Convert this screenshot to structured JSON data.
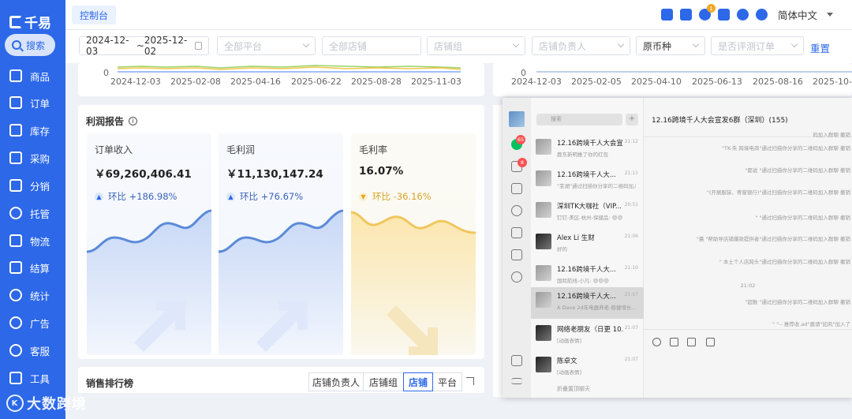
{
  "app": {
    "logo_text": "千易",
    "search_label": "搜索",
    "watermark": "大数跨境"
  },
  "sidebar": {
    "items": [
      {
        "label": "商品",
        "icon": "package-icon"
      },
      {
        "label": "订单",
        "icon": "order-icon"
      },
      {
        "label": "库存",
        "icon": "warehouse-icon"
      },
      {
        "label": "采购",
        "icon": "cart-icon"
      },
      {
        "label": "分销",
        "icon": "distribution-icon"
      },
      {
        "label": "托管",
        "icon": "hosting-icon"
      },
      {
        "label": "物流",
        "icon": "truck-icon"
      },
      {
        "label": "结算",
        "icon": "settlement-icon"
      },
      {
        "label": "统计",
        "icon": "pie-chart-icon"
      },
      {
        "label": "广告",
        "icon": "ad-icon"
      },
      {
        "label": "客服",
        "icon": "headset-icon"
      },
      {
        "label": "工具",
        "icon": "tools-icon"
      }
    ]
  },
  "topbar": {
    "tab_label": "控制台",
    "notification_count": "1",
    "language": "简体中文"
  },
  "filters": {
    "date_start": "2024-12-03",
    "date_sep": "~",
    "date_end": "2025-12-02",
    "platform_placeholder": "全部平台",
    "store_placeholder": "全部店铺",
    "store_group_placeholder": "店铺组",
    "store_owner_placeholder": "店铺负责人",
    "currency": "原币种",
    "review_placeholder": "是否评测订单",
    "reset_label": "重置"
  },
  "chart_left": {
    "y_zero": "0",
    "ticks": [
      "2024-12-03",
      "2025-02-08",
      "2025-04-16",
      "2025-06-22",
      "2025-08-28",
      "2025-11-03"
    ]
  },
  "chart_right": {
    "y_zero": "0",
    "ticks": [
      "2024-12-03",
      "2025-02-05",
      "2025-04-10",
      "2025-06-13",
      "2025-08-16",
      "2025-10-"
    ]
  },
  "chart_data": [
    {
      "type": "line",
      "x": [
        "2024-12-03",
        "2025-02-08",
        "2025-04-16",
        "2025-06-22",
        "2025-08-28",
        "2025-11-03"
      ],
      "series": [],
      "xlabel": "",
      "ylabel": "",
      "y_tick_labels": [
        "0"
      ]
    },
    {
      "type": "line",
      "x": [
        "2024-12-03",
        "2025-02-05",
        "2025-04-10",
        "2025-06-13",
        "2025-08-16",
        "2025-10-"
      ],
      "series": [],
      "xlabel": "",
      "ylabel": "",
      "y_tick_labels": [
        "0"
      ]
    }
  ],
  "profit": {
    "title": "利润报告",
    "info_symbol": "i",
    "cards": [
      {
        "label": "订单收入",
        "value": "￥69,260,406.41",
        "trend": "环比 +186.98%",
        "direction": "up",
        "color": "#5b8bd8"
      },
      {
        "label": "毛利润",
        "value": "￥11,130,147.24",
        "trend": "环比 +76.67%",
        "direction": "up",
        "color": "#5b8bd8"
      },
      {
        "label": "毛利率",
        "value": "16.07%",
        "trend": "环比 -36.16%",
        "direction": "down",
        "color": "#f0c75e"
      }
    ]
  },
  "ranking": {
    "title": "销售排行榜",
    "tabs": [
      "店铺负责人",
      "店铺组",
      "店铺",
      "平台"
    ],
    "active_tab": "店铺"
  },
  "chat": {
    "search_placeholder": "搜索",
    "plus": "+",
    "rail_badges": [
      "65",
      "8"
    ],
    "conversations": [
      {
        "name": "12.16跨境千人大会宣...",
        "time": "21:12",
        "msg": "鹿东新明推了你的红包"
      },
      {
        "name": "12.16跨境千人大...",
        "time": "21:11",
        "msg": "\"芜湖\"通过扫描你分享的二维码加入..."
      },
      {
        "name": "深圳TK大咖社（VIP...",
        "time": "20:51",
        "msg": "钉钉-美区-杭州-保健品: 😄😄"
      },
      {
        "name": "Alex Li 生财",
        "time": "21:06",
        "msg": "好的"
      },
      {
        "name": "12.16跨境千人大...",
        "time": "21:10",
        "msg": "国际航线-小凡: 😄😄😄"
      },
      {
        "name": "12.16跨境千人大...",
        "time": "21:07",
        "msg": "A Dave 2d年电器养老-稳健增长..."
      },
      {
        "name": "网络老朋友（日更 10...",
        "time": "21:07",
        "msg": "[动画表情]"
      },
      {
        "name": "陈卓文",
        "time": "21:07",
        "msg": "[动画表情]"
      }
    ],
    "collapse_label": "折叠置顶聊天",
    "title": "12.16跨境千人大会宣发6群（深圳）(155)",
    "messages": [
      "码加入群聊  撤销",
      "\"TK-朱 跨境电商\"通过扫描你分享的二维码加入群聊  撤销",
      "\"都说 \"通过扫描你分享的二维码加入群聊  撤销",
      "\"(开展服装、寄窗银行)\"通过扫描你分享的二维码加入群聊  撤销",
      "\"      \"通过扫描你分享的二维码加入群聊  撤销",
      "\"晨   \"帮助导店铺爆款提供者\"通过扫描你分享的二维码加入群聊  撤销",
      "\"   本土个人店跨头\"通过扫描你分享的二维码加入群聊  撤销",
      "\"超数    \"通过扫描你分享的二维码加入群聊  撤销",
      "\"         \"-- 推荐收.ad\"邀请\"如风\"加入了"
    ],
    "time_divider": "21:02"
  }
}
